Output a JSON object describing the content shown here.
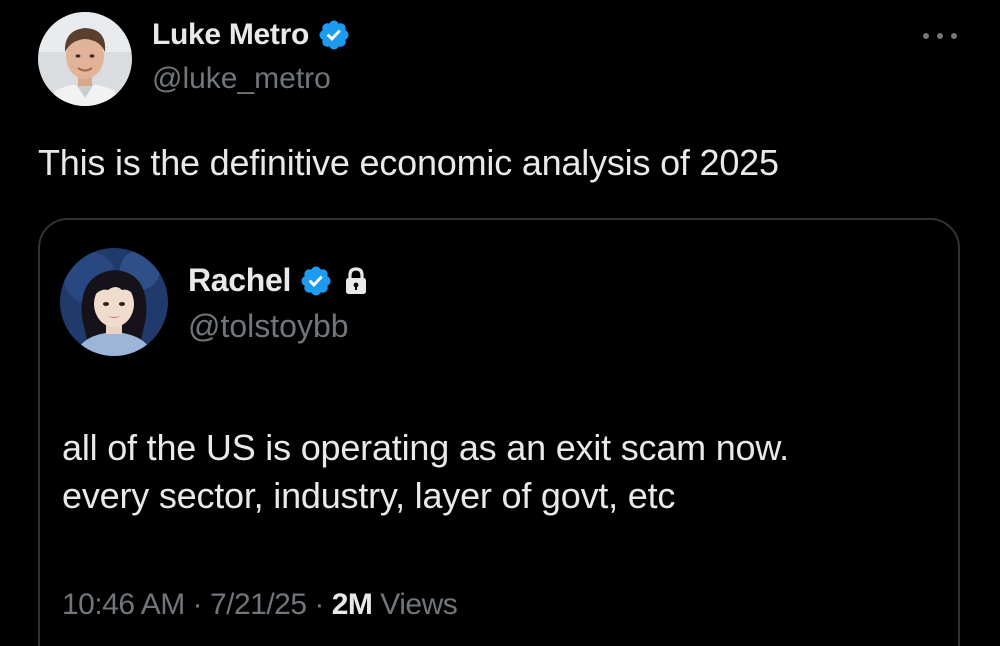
{
  "tweet": {
    "author": {
      "name": "Luke Metro",
      "handle": "@luke_metro",
      "verified": true,
      "avatar_icon": "person-avatar-man"
    },
    "text": "This is the definitive economic analysis of 2025",
    "more_icon": "more-horizontal-icon"
  },
  "quote": {
    "author": {
      "name": "Rachel",
      "handle": "@tolstoybb",
      "verified": true,
      "protected": true,
      "avatar_icon": "person-avatar-painted-portrait"
    },
    "text_lines": [
      "all of the US is operating as an exit scam now.",
      "every sector, industry, layer of govt, etc"
    ],
    "time": "10:46 AM",
    "date": "7/21/25",
    "separator": "·",
    "views_count": "2M",
    "views_label": "Views"
  },
  "colors": {
    "background": "#000000",
    "text_primary": "#e7e9ea",
    "text_secondary": "#71767b",
    "verified_blue": "#1d9bf0",
    "border": "#2f3336"
  }
}
